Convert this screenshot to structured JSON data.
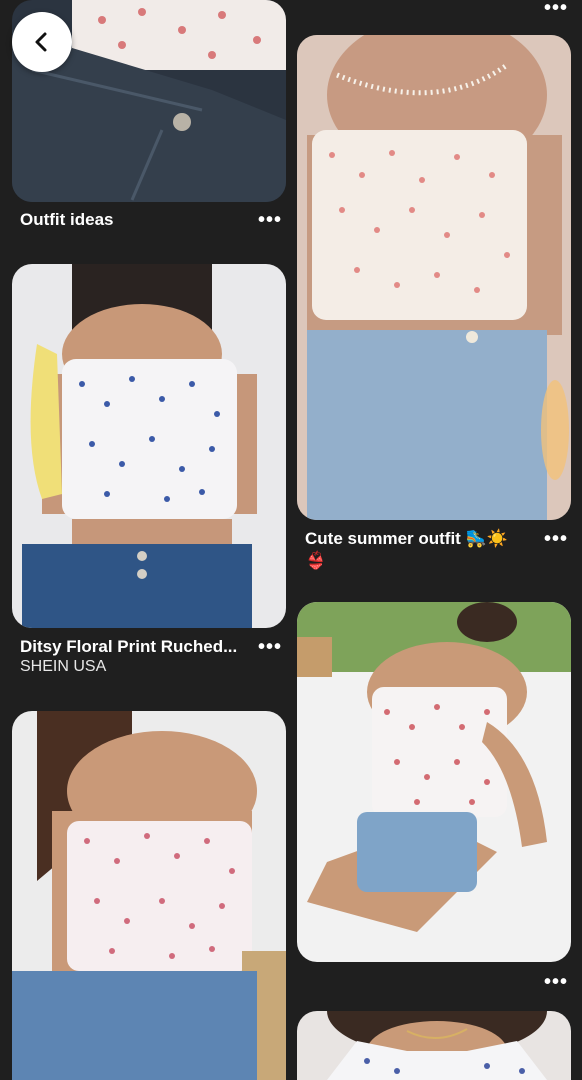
{
  "feed": {
    "left": [
      {
        "title": "Outfit ideas",
        "more": "•••"
      },
      {
        "title": "Ditsy Floral Print Ruched...",
        "source": "SHEIN USA",
        "more": "•••"
      },
      {
        "title": "",
        "more": ""
      }
    ],
    "right": [
      {
        "title": "",
        "more": "•••"
      },
      {
        "title": "Cute summer outfit 🛼☀️👙",
        "more": "•••"
      },
      {
        "title": "",
        "more": "•••"
      },
      {
        "title": "",
        "more": ""
      }
    ]
  },
  "nav": {
    "back_icon": "chevron-left-icon"
  },
  "colors": {
    "background": "#1f1f1f",
    "text": "#ffffff",
    "denim": "#2c4a6e",
    "light_denim": "#8fb0cf"
  }
}
